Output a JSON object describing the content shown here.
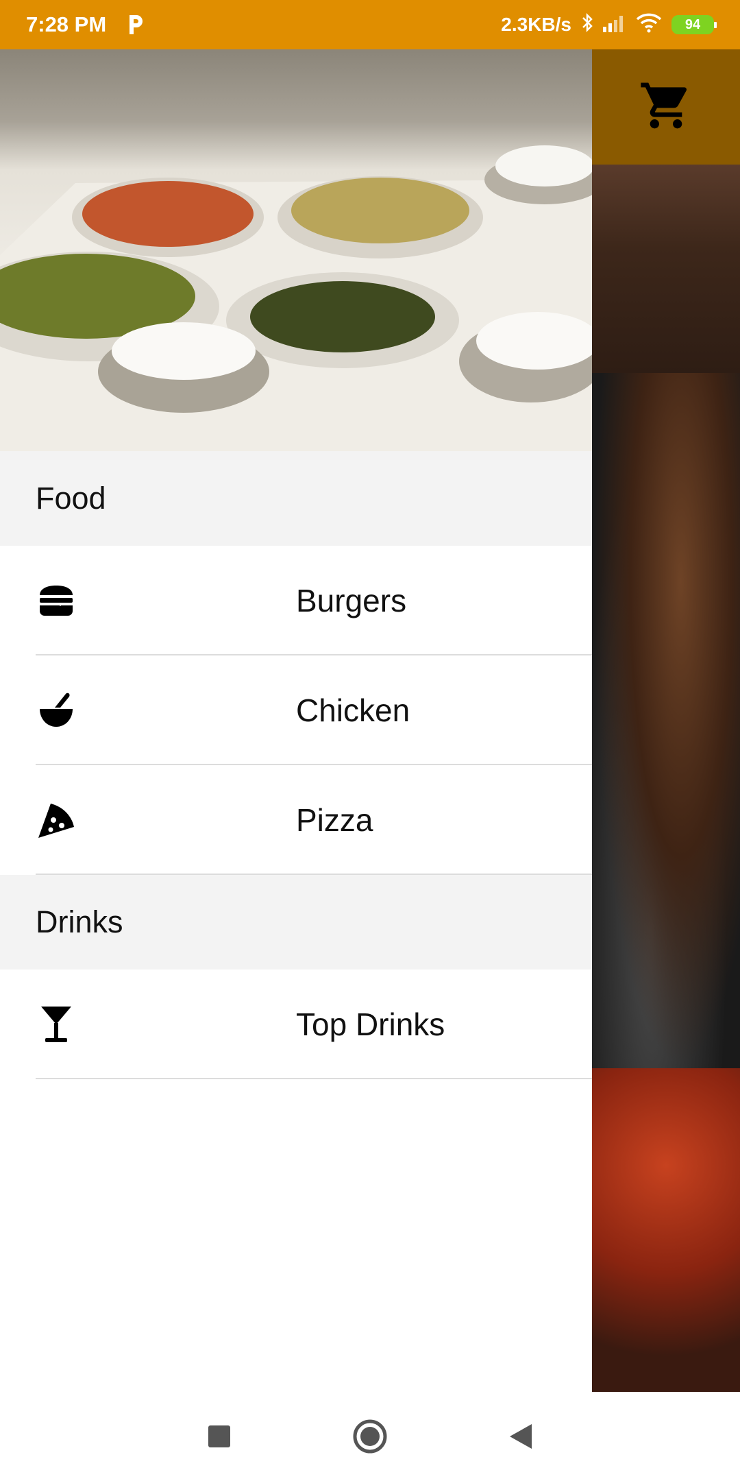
{
  "status_bar": {
    "time": "7:28 PM",
    "network_speed": "2.3KB/s",
    "battery": "94",
    "icons": [
      "p-app-icon",
      "bluetooth-icon",
      "signal-icon",
      "wifi-icon",
      "battery-icon"
    ]
  },
  "toolbar": {
    "cart_icon": "shopping-cart-icon",
    "accent_color": "#8a5a00"
  },
  "colors": {
    "status_bar": "#E08E00",
    "section_header_bg": "#F3F3F3"
  },
  "drawer": {
    "sections": [
      {
        "title": "Food",
        "items": [
          {
            "label": "Burgers",
            "icon": "burger-icon"
          },
          {
            "label": "Chicken",
            "icon": "mortar-pestle-icon"
          },
          {
            "label": "Pizza",
            "icon": "pizza-slice-icon"
          }
        ]
      },
      {
        "title": "Drinks",
        "items": [
          {
            "label": "Top Drinks",
            "icon": "cocktail-icon"
          }
        ]
      }
    ]
  },
  "nav_bar": {
    "buttons": [
      "recents-button",
      "home-button",
      "back-button"
    ]
  }
}
